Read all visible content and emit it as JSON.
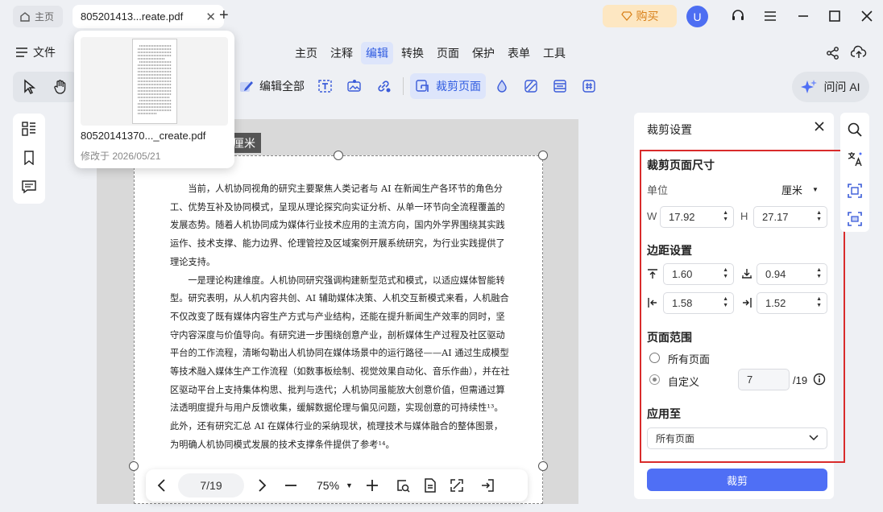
{
  "tabs": {
    "home": "主页",
    "doc": "805201413...reate.pdf"
  },
  "buy_label": "购买",
  "avatar_initial": "U",
  "file_menu": "文件",
  "main_menu": [
    "主页",
    "注释",
    "编辑",
    "转换",
    "页面",
    "保护",
    "表单",
    "工具"
  ],
  "active_menu": "编辑",
  "toolbar": {
    "edit_all": "编辑全部",
    "crop_page": "裁剪页面",
    "ask_ai": "问问 AI"
  },
  "popup": {
    "filename": "80520141370..._create.pdf",
    "modified": "修改于 2026/05/21"
  },
  "unit_tag": "厘米",
  "document": {
    "paragraphs": [
      "当前，人机协同视角的研究主要聚焦人类记者与 AI 在新闻生产各环节的角色分工、优势互补及协同模式，呈现从理论探究向实证分析、从单一环节向全流程覆盖的发展态势。随着人机协同成为媒体行业技术应用的主流方向，国内外学界围绕其实践运作、技术支撑、能力边界、伦理管控及区域案例开展系统研究，为行业实践提供了理论支持。",
      "一是理论构建维度。人机协同研究强调构建新型范式和模式，以适应媒体智能转型。研究表明，从人机内容共创、AI 辅助媒体决策、人机交互新模式来看，人机融合不仅改变了既有媒体内容生产方式与产业结构，还能在提升新闻生产效率的同时，坚守内容深度与价值导向。有研究进一步围绕创意产业，剖析媒体生产过程及社区驱动平台的工作流程，清晰勾勒出人机协同在媒体场景中的运行路径——AI 通过生成模型等技术融入媒体生产工作流程（如数事板绘制、视觉效果自动化、音乐作曲），并在社区驱动平台上支持集体构思、批判与迭代；人机协同虽能放大创意价值，但需通过算法透明度提升与用户反馈收集，缓解数据伦理与偏见问题，实现创意的可持续性¹³。此外，还有研究汇总 AI 在媒体行业的采纳现状，梳理技术与媒体融合的整体图景，为明确人机协同模式发展的技术支撑条件提供了参考¹⁴。"
    ]
  },
  "page_nav": {
    "page": "7/19",
    "zoom": "75%"
  },
  "crop_panel": {
    "title": "裁剪设置",
    "size_title": "裁剪页面尺寸",
    "unit_label": "单位",
    "unit_value": "厘米",
    "w_label": "W",
    "w_value": "17.92",
    "h_label": "H",
    "h_value": "27.17",
    "margin_title": "边距设置",
    "margin_top": "1.60",
    "margin_bottom": "0.94",
    "margin_left": "1.58",
    "margin_right": "1.52",
    "range_title": "页面范围",
    "range_all": "所有页面",
    "range_custom": "自定义",
    "custom_value": "7",
    "total_pages": "/19",
    "apply_title": "应用至",
    "apply_value": "所有页面",
    "crop_button": "裁剪"
  },
  "colors": {
    "accent": "#4f6ff5",
    "highlight_box": "#d92b2b",
    "buy_bg": "#fde7c2",
    "buy_text": "#d9821c"
  }
}
